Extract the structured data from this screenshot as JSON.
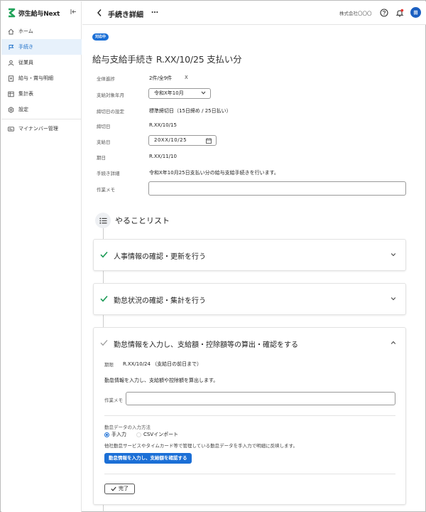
{
  "app": {
    "brand_name": "弥生給与Next",
    "collapse_icon": "panel-collapse-icon"
  },
  "sidebar": {
    "items": [
      {
        "label": "ホーム",
        "icon": "home-icon"
      },
      {
        "label": "手続き",
        "icon": "flag-icon",
        "active": true
      },
      {
        "label": "従業員",
        "icon": "person-icon"
      },
      {
        "label": "給与・賞与明細",
        "icon": "document-icon"
      },
      {
        "label": "集計表",
        "icon": "table-icon"
      },
      {
        "label": "設定",
        "icon": "gear-icon"
      },
      {
        "label": "マイナンバー管理",
        "icon": "id-card-icon"
      }
    ]
  },
  "header": {
    "back_icon": "chevron-left-icon",
    "title": "手続き詳細",
    "more_label": "…",
    "company": "株式会社〇〇〇",
    "help_icon": "help-icon",
    "notification_icon": "bell-icon",
    "avatar_initials": "田"
  },
  "procedure": {
    "status": "対応中",
    "title": "給与支給手続き R.XX/10/25 支払い分",
    "fields": {
      "total_count": {
        "label": "全体進捗",
        "value": "2件/全9件",
        "extra": "X"
      },
      "target_month": {
        "label": "支給対象年月",
        "value": "令和X年10月"
      },
      "closing_setting": {
        "label": "締切日の設定",
        "value": "標準締切日（15日締め / 25日払い）"
      },
      "closing_date": {
        "label": "締切日",
        "value": "R.XX/10/15"
      },
      "pay_date": {
        "label": "支給日",
        "value": "20XX/10/25"
      },
      "due_date": {
        "label": "期日",
        "value": "R.XX/11/10"
      },
      "detail": {
        "label": "手続き詳細",
        "value": "令和X年10月25日支払い分の給与支給手続きを行います。"
      },
      "memo": {
        "label": "作業メモ",
        "value": ""
      }
    }
  },
  "todo": {
    "heading": "やることリスト",
    "icon": "list-icon",
    "cards": [
      {
        "title": "人事情報の確認・更新を行う",
        "status": "done",
        "expanded": false
      },
      {
        "title": "勤怠状況の確認・集計を行う",
        "status": "done",
        "expanded": false
      },
      {
        "title": "勤怠情報を入力し、支給額・控除額等の算出・確認をする",
        "status": "pending",
        "expanded": true,
        "deadline_label": "期限",
        "deadline_value": "R.XX/10/24 （支給日の前日まで）",
        "description": "勤怠情報を入力し、支給額や控除額を算出します。",
        "memo_label": "作業メモ",
        "input_method_label": "勤怠データの入力方法",
        "options": [
          "手入力",
          "CSVインポート"
        ],
        "selected_option": "手入力",
        "input_note": "他社勤怠サービスやタイムカード等で管理している勤怠データを手入力で明細に反映します。",
        "primary_button": "勤怠情報を入力し、支給額を確認する",
        "done_button": "完了"
      }
    ]
  },
  "colors": {
    "accent": "#1b6fd6",
    "check_green": "#1a9a55",
    "brand_green": "#22a35a"
  }
}
